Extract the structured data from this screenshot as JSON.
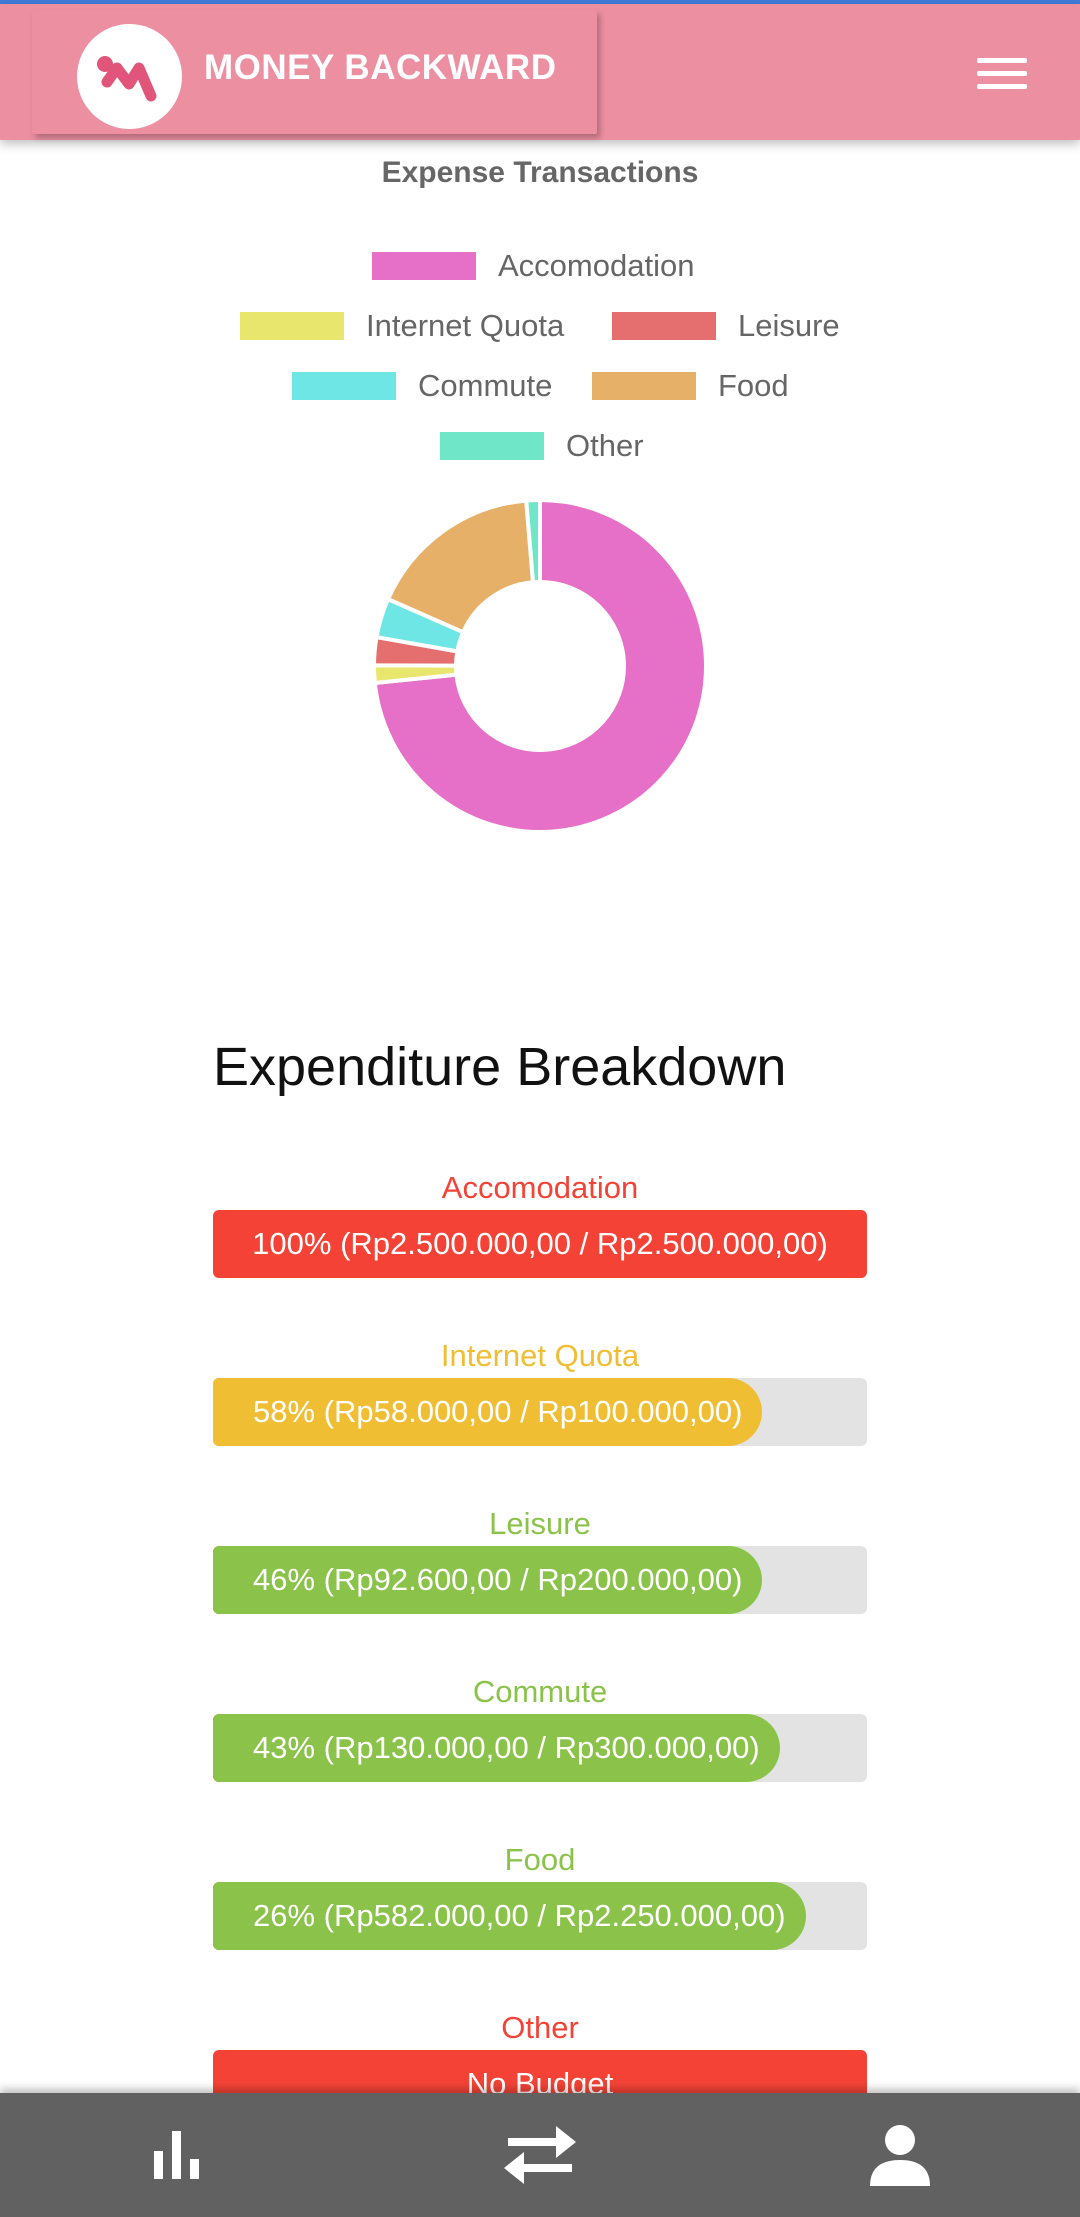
{
  "app": {
    "title": "MONEY BACKWARD"
  },
  "icons": {
    "logo": "money-backward-logo",
    "menu": "hamburger-menu-icon",
    "stats": "bar-chart-icon",
    "transactions": "swap-arrows-icon",
    "profile": "person-icon"
  },
  "colors": {
    "header": "#ec8fa1",
    "over_budget": "#f44336",
    "warning": "#f0be32",
    "ok": "#8bc34a",
    "nav": "#616161"
  },
  "chart_data": {
    "type": "pie",
    "title": "Expense Transactions",
    "legend_position": "top",
    "donut": true,
    "series": [
      {
        "name": "Accomodation",
        "value": 2500000,
        "color": "#e66fc8"
      },
      {
        "name": "Internet Quota",
        "value": 58000,
        "color": "#e8e66c"
      },
      {
        "name": "Leisure",
        "value": 92600,
        "color": "#e56f6f"
      },
      {
        "name": "Commute",
        "value": 130000,
        "color": "#6fe6e6"
      },
      {
        "name": "Food",
        "value": 582000,
        "color": "#e7b068"
      },
      {
        "name": "Other",
        "value": 45000,
        "color": "#6fe6c8"
      }
    ]
  },
  "breakdown": {
    "title": "Expenditure Breakdown",
    "items": [
      {
        "label": "Accomodation",
        "text": "100% (Rp2.500.000,00 / Rp2.500.000,00)",
        "percent": 100,
        "color": "#f44336"
      },
      {
        "label": "Internet Quota",
        "text": "58% (Rp58.000,00 / Rp100.000,00)",
        "percent": 58,
        "color": "#f0be32"
      },
      {
        "label": "Leisure",
        "text": "46% (Rp92.600,00 / Rp200.000,00)",
        "percent": 46,
        "color": "#8bc34a"
      },
      {
        "label": "Commute",
        "text": "43% (Rp130.000,00 / Rp300.000,00)",
        "percent": 43,
        "color": "#8bc34a"
      },
      {
        "label": "Food",
        "text": "26% (Rp582.000,00 / Rp2.250.000,00)",
        "percent": 26,
        "color": "#8bc34a"
      },
      {
        "label": "Other",
        "text": "No Budget",
        "percent": 100,
        "color": "#f44336"
      }
    ]
  }
}
